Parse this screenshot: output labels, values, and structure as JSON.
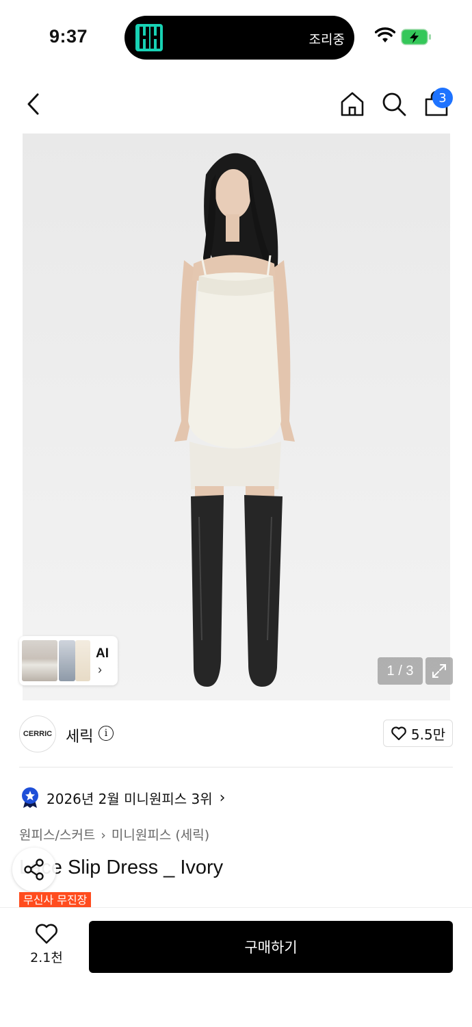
{
  "status_bar": {
    "time": "9:37",
    "activity_text": "조리중",
    "accent_color": "#18d2b4",
    "icons": [
      "app-logo-icon",
      "wifi-icon",
      "battery-charging-icon"
    ]
  },
  "nav": {
    "cart_count": "3",
    "icons": [
      "back-icon",
      "home-icon",
      "search-icon",
      "shopping-bag-icon"
    ]
  },
  "gallery": {
    "page_indicator": "1 / 3",
    "ai_label": "AI",
    "ai_chevron": "›",
    "icons": [
      "expand-icon"
    ]
  },
  "brand": {
    "logo_text": "CERRIC",
    "name": "세릭",
    "info_glyph": "i",
    "like_count": "5.5만"
  },
  "ranking": {
    "text": "2026년 2월 미니원피스 3위",
    "chevron": "›",
    "badge_color": "#1e4fd8"
  },
  "category": {
    "primary": "원피스/스커트",
    "separator": "›",
    "secondary": "미니원피스 (세릭)"
  },
  "product": {
    "name": "Lace Slip Dress _ Ivory",
    "promo_badge": "무신사 무진장",
    "promo_color": "#ff4c1e"
  },
  "bottom_bar": {
    "wish_count": "2.1천",
    "buy_label": "구매하기"
  }
}
